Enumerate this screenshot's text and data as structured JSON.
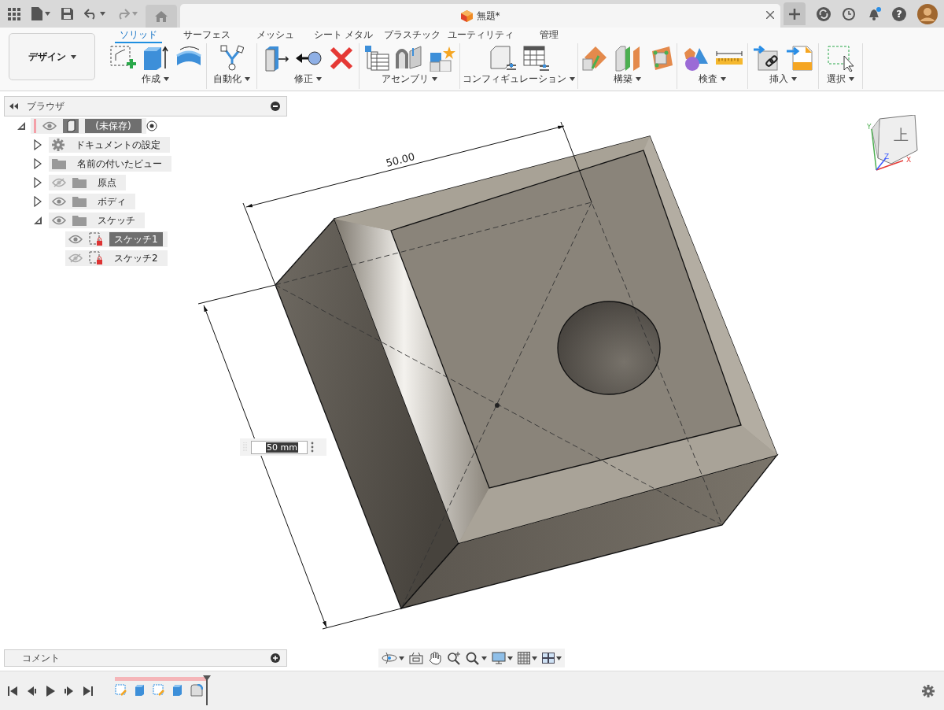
{
  "app_bar": {
    "document_title": "無題*",
    "help_label": "?"
  },
  "workspace": {
    "label": "デザイン"
  },
  "ribbon_tabs": [
    {
      "label": "ソリッド",
      "selected": true
    },
    {
      "label": "サーフェス",
      "selected": false
    },
    {
      "label": "メッシュ",
      "selected": false
    },
    {
      "label": "シート メタル",
      "selected": false
    },
    {
      "label": "プラスチック",
      "selected": false
    },
    {
      "label": "ユーティリティ",
      "selected": false
    },
    {
      "label": "管理",
      "selected": false
    }
  ],
  "ribbon_groups": [
    {
      "label": "作成"
    },
    {
      "label": "自動化"
    },
    {
      "label": "修正"
    },
    {
      "label": "アセンブリ"
    },
    {
      "label": "コンフィギュレーション"
    },
    {
      "label": "構築"
    },
    {
      "label": "検査"
    },
    {
      "label": "挿入"
    },
    {
      "label": "選択"
    }
  ],
  "browser": {
    "title": "ブラウザ",
    "items": [
      {
        "label": "(未保存)",
        "kind": "component",
        "expanded": true,
        "visible": true,
        "selected": true,
        "children": [
          {
            "label": "ドキュメントの設定",
            "kind": "settings",
            "expanded": false,
            "selected": false
          },
          {
            "label": "名前の付いたビュー",
            "kind": "folder",
            "expanded": false,
            "selected": false
          },
          {
            "label": "原点",
            "kind": "folder",
            "expanded": false,
            "visible": false,
            "selected": false
          },
          {
            "label": "ボディ",
            "kind": "folder",
            "expanded": false,
            "visible": true,
            "selected": false
          },
          {
            "label": "スケッチ",
            "kind": "folder",
            "expanded": true,
            "visible": true,
            "selected": false,
            "children": [
              {
                "label": "スケッチ1",
                "kind": "sketch",
                "visible": true,
                "selected": true
              },
              {
                "label": "スケッチ2",
                "kind": "sketch",
                "visible": false,
                "selected": false
              }
            ]
          }
        ]
      }
    ]
  },
  "viewport": {
    "dimension_label": "50.00",
    "dimension_input": {
      "value": "50 mm"
    },
    "viewcube": {
      "face": "上",
      "axes": [
        "X",
        "Y",
        "Z"
      ]
    }
  },
  "comments": {
    "title": "コメント"
  }
}
